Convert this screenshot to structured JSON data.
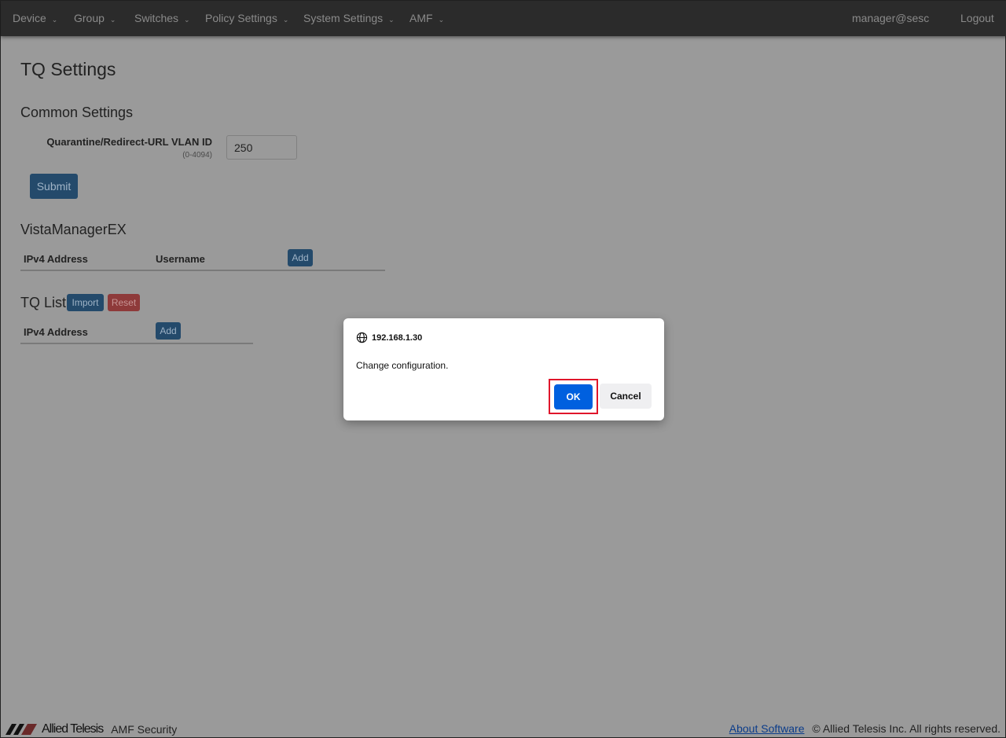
{
  "nav": {
    "items": [
      "Device",
      "Group",
      "Switches",
      "Policy Settings",
      "System Settings",
      "AMF"
    ],
    "user": "manager@sesc",
    "logout": "Logout"
  },
  "page": {
    "title": "TQ Settings"
  },
  "common": {
    "heading": "Common Settings",
    "vlan_label": "Quarantine/Redirect-URL VLAN ID",
    "vlan_hint": "(0-4094)",
    "vlan_value": "250",
    "submit": "Submit"
  },
  "vista": {
    "heading": "VistaManagerEX",
    "col_ipv4": "IPv4 Address",
    "col_username": "Username",
    "add": "Add"
  },
  "tq": {
    "heading": "TQ List",
    "import": "Import",
    "reset": "Reset",
    "col_ipv4": "IPv4 Address",
    "add": "Add"
  },
  "dialog": {
    "origin": "192.168.1.30",
    "message": "Change configuration.",
    "ok": "OK",
    "cancel": "Cancel"
  },
  "footer": {
    "brand": "Allied Telesis",
    "product": "AMF Security",
    "about": "About Software",
    "copyright": "© Allied Telesis Inc. All rights reserved."
  }
}
